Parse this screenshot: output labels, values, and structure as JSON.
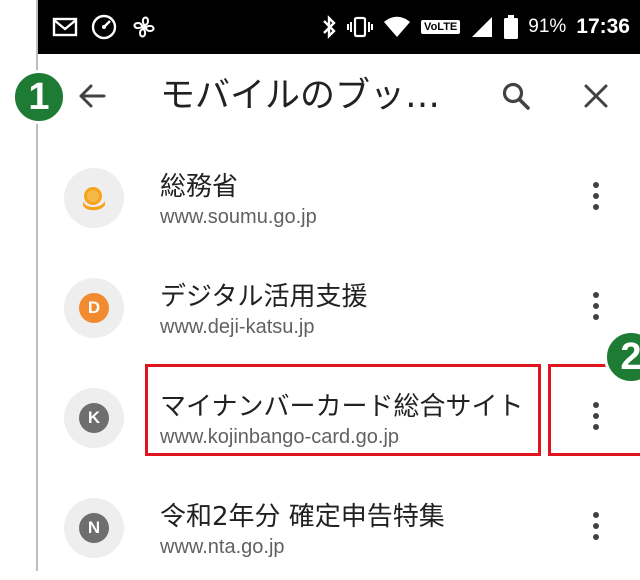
{
  "status_bar": {
    "battery": "91%",
    "time": "17:36",
    "network_label": "VoLTE",
    "icons": [
      "gmail-icon",
      "speed-icon",
      "fan-icon",
      "bluetooth-icon",
      "vibrate-icon",
      "wifi-icon",
      "volte-icon",
      "signal-icon",
      "battery-icon"
    ]
  },
  "toolbar": {
    "title": "モバイルのブッ…",
    "back_icon": "back-arrow-icon",
    "search_icon": "search-icon",
    "close_icon": "close-icon"
  },
  "annotations": {
    "badge_1": "1",
    "badge_2": "2",
    "highlight_color": "#e0141e",
    "badge_color": "#1e7b34"
  },
  "bookmarks": [
    {
      "title": "総務省",
      "url": "www.soumu.go.jp",
      "icon": "soumu-favicon",
      "letter": "",
      "color": "#f5a31a"
    },
    {
      "title": "デジタル活用支援",
      "url": "www.deji-katsu.jp",
      "icon": "letter-favicon",
      "letter": "D",
      "color": "#f28a30"
    },
    {
      "title": "マイナンバーカード総合サイト",
      "url": "www.kojinbango-card.go.jp",
      "icon": "letter-favicon",
      "letter": "K",
      "color": "#6e6e6e"
    },
    {
      "title": "令和2年分 確定申告特集",
      "url": "www.nta.go.jp",
      "icon": "letter-favicon",
      "letter": "N",
      "color": "#6e6e6e"
    }
  ]
}
